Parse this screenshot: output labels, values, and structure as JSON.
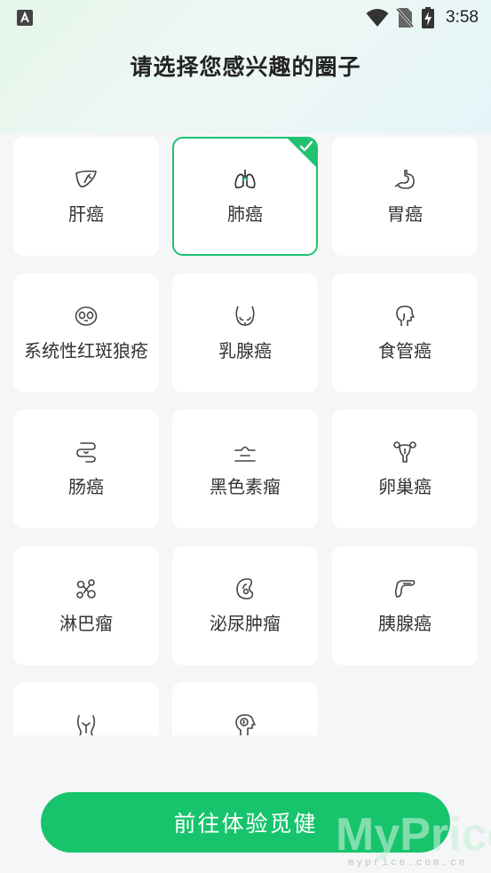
{
  "status_bar": {
    "time": "3:58"
  },
  "page": {
    "title": "请选择您感兴趣的圈子"
  },
  "circles": [
    {
      "label": "肝癌",
      "icon": "liver-icon",
      "selected": false
    },
    {
      "label": "肺癌",
      "icon": "lungs-icon",
      "selected": true
    },
    {
      "label": "胃癌",
      "icon": "stomach-icon",
      "selected": false
    },
    {
      "label": "系统性红斑狼疮",
      "icon": "face-mask-icon",
      "selected": false
    },
    {
      "label": "乳腺癌",
      "icon": "breast-icon",
      "selected": false
    },
    {
      "label": "食管癌",
      "icon": "head-throat-icon",
      "selected": false
    },
    {
      "label": "肠癌",
      "icon": "intestine-icon",
      "selected": false
    },
    {
      "label": "黑色素瘤",
      "icon": "skin-mole-icon",
      "selected": false
    },
    {
      "label": "卵巢癌",
      "icon": "uterus-icon",
      "selected": false
    },
    {
      "label": "淋巴瘤",
      "icon": "lymph-node-icon",
      "selected": false
    },
    {
      "label": "泌尿肿瘤",
      "icon": "kidney-icon",
      "selected": false
    },
    {
      "label": "胰腺癌",
      "icon": "pancreas-icon",
      "selected": false
    },
    {
      "label": "",
      "icon": "pelvis-icon",
      "selected": false
    },
    {
      "label": "",
      "icon": "brain-head-icon",
      "selected": false
    }
  ],
  "cta": {
    "label": "前往体验觅健"
  },
  "watermark": {
    "brand": "MyPrice",
    "domain": "myprice.com.cn"
  },
  "colors": {
    "accent": "#17c46c",
    "selected_border": "#1fc270"
  }
}
